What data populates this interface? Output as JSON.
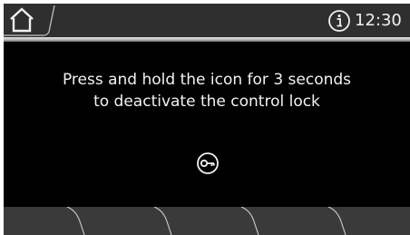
{
  "status_bar": {
    "time": "12:30",
    "home_icon": "home-icon",
    "info_icon": "info-icon"
  },
  "message": {
    "line1": "Press and hold the icon for 3 seconds",
    "line2": "to deactivate the control lock"
  },
  "lock_icon": "key-icon",
  "softkeys": [
    "",
    "",
    "",
    "",
    ""
  ],
  "colors": {
    "screen_background": "#000000",
    "top_bar": "#2f2f2f",
    "bottom_bar": "#3a3a3a",
    "text": "#f2f2f2"
  }
}
